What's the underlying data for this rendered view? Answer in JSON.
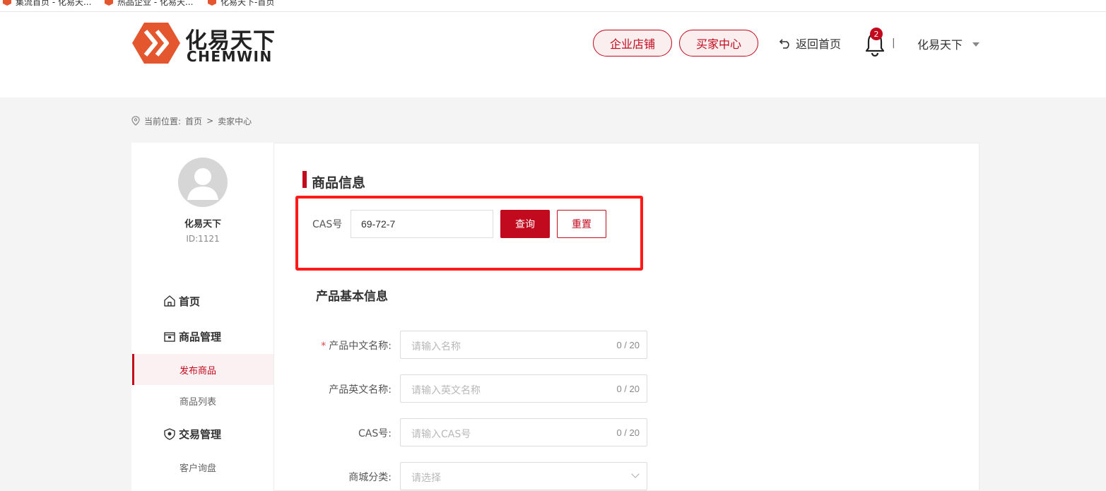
{
  "bookmarks": [
    {
      "label": "集流首页 - 化易天..."
    },
    {
      "label": "热品企业 - 化易天..."
    },
    {
      "label": "化易天下-首页"
    }
  ],
  "header": {
    "logo_cn": "化易天下",
    "logo_en": "CHEMWIN",
    "btn_store": "企业店铺",
    "btn_buyer": "买家中心",
    "back_home": "返回首页",
    "notification_count": "2",
    "separator": "|",
    "user_name": "化易天下"
  },
  "breadcrumb": {
    "prefix": "当前位置:",
    "home": "首页",
    "sep": ">",
    "current": "卖家中心"
  },
  "sidebar": {
    "user_name": "化易天下",
    "user_id": "ID:1121",
    "nav": {
      "home": "首页",
      "goods_mgmt": "商品管理",
      "publish": "发布商品",
      "goods_list": "商品列表",
      "trade_mgmt": "交易管理",
      "inquiry": "客户询盘"
    }
  },
  "main": {
    "section_title": "商品信息",
    "cas_label": "CAS号",
    "cas_value": "69-72-7",
    "btn_query": "查询",
    "btn_reset": "重置",
    "basic_info_title": "产品基本信息",
    "fields": {
      "name_cn": {
        "required": "*",
        "label": "产品中文名称:",
        "placeholder": "请输入名称",
        "count": "0 / 20"
      },
      "name_en": {
        "label": "产品英文名称:",
        "placeholder": "请输入英文名称",
        "count": "0 / 20"
      },
      "cas": {
        "label": "CAS号:",
        "placeholder": "请输入CAS号",
        "count": "0 / 20"
      },
      "category": {
        "label": "商城分类:",
        "placeholder": "请选择"
      }
    }
  },
  "colors": {
    "brand": "#c20a1e",
    "logo_orange": "#e4572e",
    "highlight": "#ff1a1a"
  }
}
